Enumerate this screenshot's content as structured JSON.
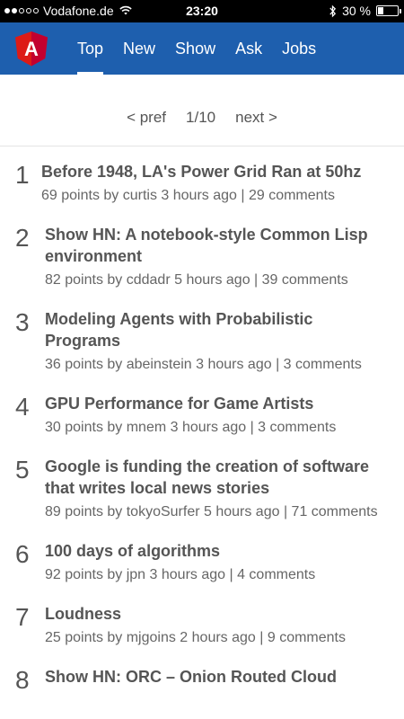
{
  "status": {
    "carrier": "Vodafone.de",
    "time": "23:20",
    "battery": "30 %",
    "battery_level": 0.3
  },
  "nav": {
    "logo_letter": "A",
    "tabs": [
      "Top",
      "New",
      "Show",
      "Ask",
      "Jobs"
    ],
    "active_tab": "Top"
  },
  "pager": {
    "prev": "< pref",
    "page": "1/10",
    "next": "next >"
  },
  "items": [
    {
      "num": "1",
      "title": "Before 1948, LA's Power Grid Ran at 50hz",
      "meta": "69 points by curtis 3 hours ago | 29 comments"
    },
    {
      "num": "2",
      "title": "Show HN: A notebook-style Common Lisp environment",
      "meta": "82 points by cddadr 5 hours ago | 39 comments"
    },
    {
      "num": "3",
      "title": "Modeling Agents with Probabilistic Programs",
      "meta": "36 points by abeinstein 3 hours ago | 3 comments"
    },
    {
      "num": "4",
      "title": "GPU Performance for Game Artists",
      "meta": "30 points by mnem 3 hours ago | 3 comments"
    },
    {
      "num": "5",
      "title": "Google is funding the creation of software that writes local news stories",
      "meta": "89 points by tokyoSurfer 5 hours ago | 71 comments"
    },
    {
      "num": "6",
      "title": "100 days of algorithms",
      "meta": "92 points by jpn 3 hours ago | 4 comments"
    },
    {
      "num": "7",
      "title": "Loudness",
      "meta": "25 points by mjgoins 2 hours ago | 9 comments"
    },
    {
      "num": "8",
      "title": "Show HN: ORC – Onion Routed Cloud",
      "meta": ""
    }
  ]
}
